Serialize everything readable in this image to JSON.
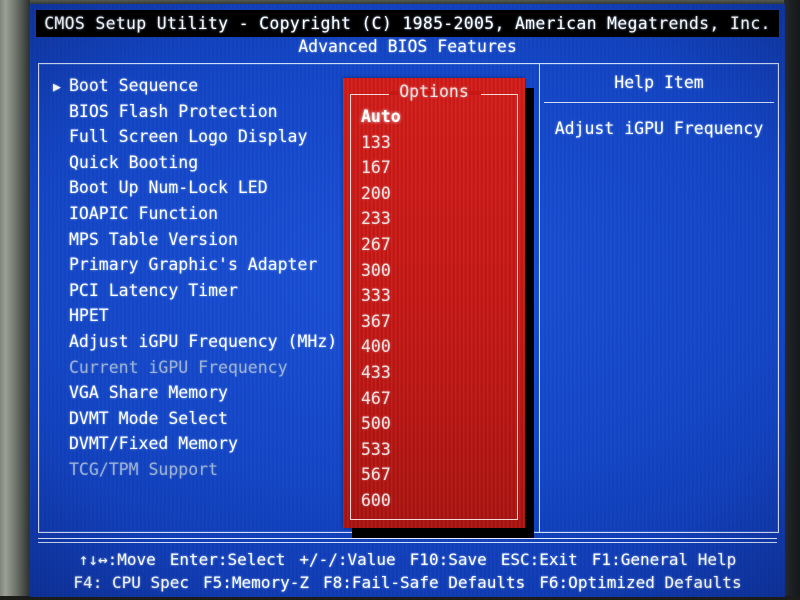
{
  "window": {
    "title": "CMOS Setup Utility - Copyright (C) 1985-2005, American Megatrends, Inc.",
    "subtitle": "Advanced BIOS Features"
  },
  "settings": {
    "items": [
      {
        "label": "Boot Sequence",
        "arrow": "▶",
        "dim": false
      },
      {
        "label": "BIOS Flash Protection",
        "arrow": "",
        "dim": false
      },
      {
        "label": "Full Screen Logo Display",
        "arrow": "",
        "dim": false
      },
      {
        "label": "Quick Booting",
        "arrow": "",
        "dim": false
      },
      {
        "label": "Boot Up Num-Lock LED",
        "arrow": "",
        "dim": false
      },
      {
        "label": "IOAPIC Function",
        "arrow": "",
        "dim": false
      },
      {
        "label": "MPS Table Version",
        "arrow": "",
        "dim": false
      },
      {
        "label": "Primary Graphic's Adapter",
        "arrow": "",
        "dim": false
      },
      {
        "label": "PCI Latency Timer",
        "arrow": "",
        "dim": false
      },
      {
        "label": "HPET",
        "arrow": "",
        "dim": false
      },
      {
        "label": "Adjust iGPU Frequency (MHz)",
        "arrow": "",
        "dim": false
      },
      {
        "label": "Current iGPU Frequency",
        "arrow": "",
        "dim": true
      },
      {
        "label": "VGA Share Memory",
        "arrow": "",
        "dim": false
      },
      {
        "label": "DVMT Mode Select",
        "arrow": "",
        "dim": false
      },
      {
        "label": "DVMT/Fixed Memory",
        "arrow": "",
        "dim": false
      },
      {
        "label": "TCG/TPM Support",
        "arrow": "",
        "dim": true
      }
    ]
  },
  "options_popup": {
    "title": "Options",
    "selected": "Auto",
    "values": [
      "Auto",
      "133",
      "167",
      "200",
      "233",
      "267",
      "300",
      "333",
      "367",
      "400",
      "433",
      "467",
      "500",
      "533",
      "567",
      "600"
    ]
  },
  "help": {
    "title": "Help Item",
    "text": "Adjust iGPU Frequency"
  },
  "statusbar": {
    "line1": [
      "↑↓↔:Move",
      "Enter:Select",
      "+/-/:Value",
      "F10:Save",
      "ESC:Exit",
      "F1:General Help"
    ],
    "line2": [
      "F4: CPU Spec",
      "F5:Memory-Z",
      "F8:Fail-Safe Defaults",
      "F6:Optimized Defaults"
    ]
  },
  "colors": {
    "screen_blue": "#1546c4",
    "popup_red": "#c41714",
    "title_bar": "#000000",
    "text_white": "#ffffff",
    "text_dim": "#9bb1d6",
    "border": "#cfdcf7"
  }
}
